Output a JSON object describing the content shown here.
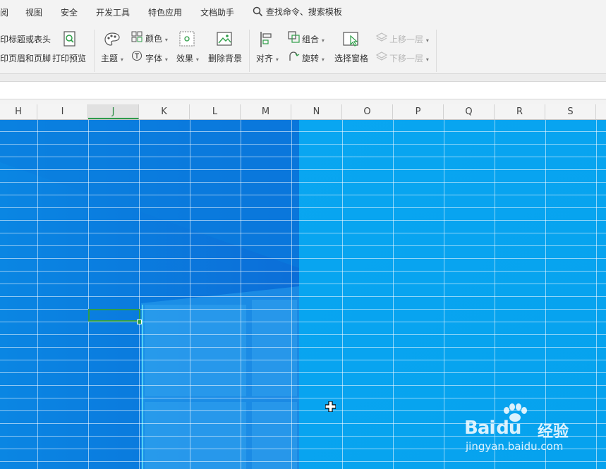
{
  "menu": {
    "items": [
      "阅",
      "视图",
      "安全",
      "开发工具",
      "特色应用",
      "文档助手"
    ],
    "search_label": "查找命令、搜索模板"
  },
  "ribbon": {
    "print_titles": "印标题或表头",
    "header_footer": "印页眉和页脚",
    "print_preview": "打印预览",
    "theme": "主题",
    "color": "颜色",
    "font": "字体",
    "effects": "效果",
    "delete_background": "删除背景",
    "align": "对齐",
    "group": "组合",
    "rotate": "旋转",
    "selection_pane": "选择窗格",
    "bring_forward": "上移一层",
    "send_backward": "下移一层"
  },
  "columns": [
    "H",
    "I",
    "J",
    "K",
    "L",
    "M",
    "N",
    "O",
    "P",
    "Q",
    "R",
    "S"
  ],
  "active_column": "J",
  "watermark": {
    "brand": "Bai",
    "brand2": "du",
    "cn": "经验",
    "url": "jingyan.baidu.com"
  },
  "colors": {
    "accent_green": "#2f9e49",
    "wallpaper_blue": "#0a8ce6"
  }
}
